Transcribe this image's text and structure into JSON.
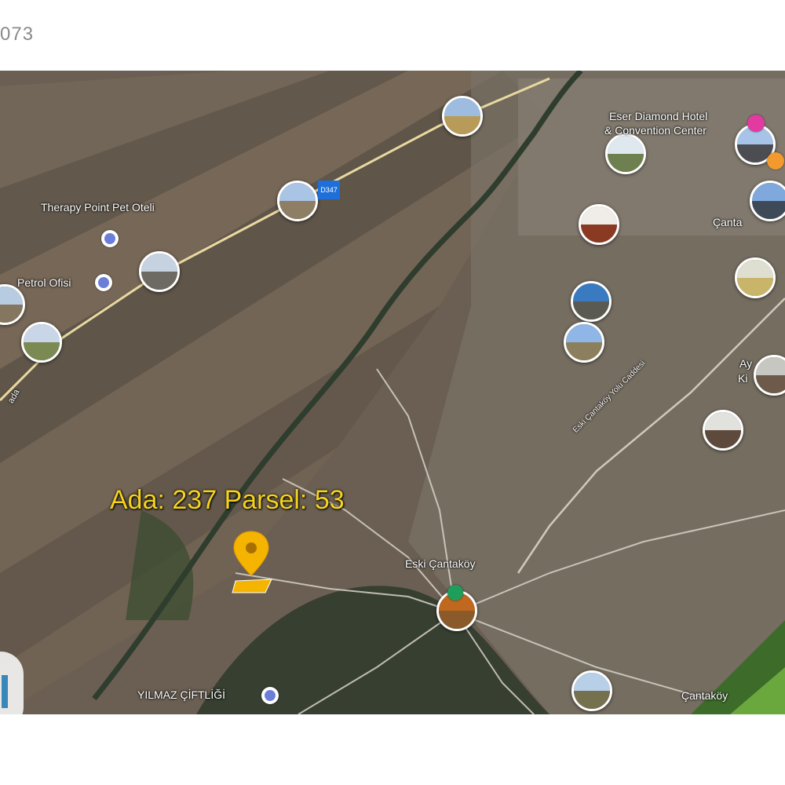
{
  "header": {
    "id_text": "073"
  },
  "map": {
    "parcel_label": "Ada: 237  Parsel: 53",
    "road_badge": "D347",
    "place_labels": {
      "therapy": "Therapy Point Pet Oteli",
      "petrol": "Petrol Ofisi",
      "eser": "Eser Diamond Hotel",
      "convention": "& Convention Center",
      "canta_top": "Çanta",
      "ay": "Ay",
      "ki": "Ki",
      "eski": "Eski Çantaköy",
      "yilmaz": "YILMAZ ÇİFTLİĞİ",
      "cantakoy": "Çantaköy",
      "eski_road": "Eski Çantaköy Yolu Caddesi",
      "left_road": "ada"
    },
    "colors": {
      "parcel_label": "#f5d21e",
      "pin": "#f5b400",
      "poi": "#6c7fd8",
      "badge": "#1e6fd9"
    }
  }
}
